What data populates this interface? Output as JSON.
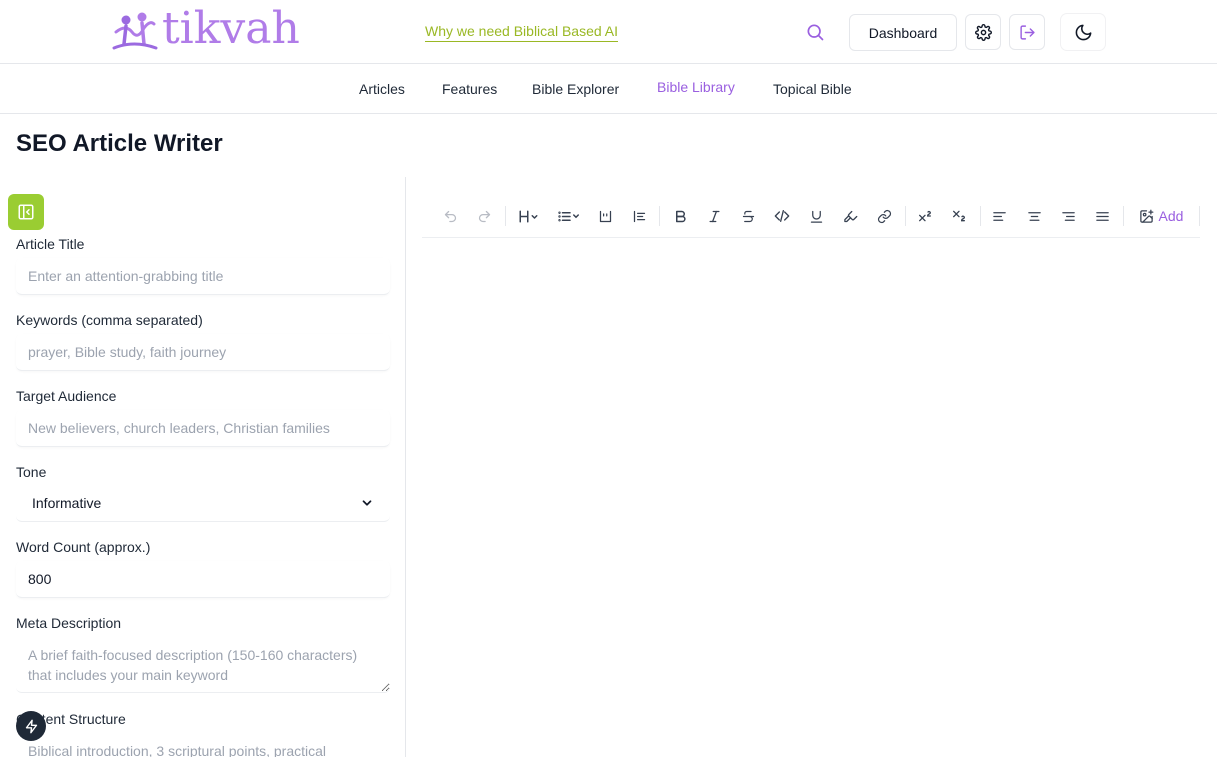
{
  "header": {
    "logo_text": "tikvah",
    "tagline": "Why we need Biblical Based AI",
    "dashboard_label": "Dashboard",
    "accent_color": "#9a5fe0",
    "tagline_color": "#9ab824"
  },
  "nav": {
    "items": [
      {
        "label": "Articles"
      },
      {
        "label": "Features"
      },
      {
        "label": "Bible Explorer"
      },
      {
        "label": "Bible Library",
        "active": true
      },
      {
        "label": "Topical Bible"
      }
    ]
  },
  "page": {
    "title": "SEO Article Writer"
  },
  "form": {
    "article_title": {
      "label": "Article Title",
      "value": "",
      "placeholder": "Enter an attention-grabbing title"
    },
    "keywords": {
      "label": "Keywords (comma separated)",
      "value": "",
      "placeholder": "prayer, Bible study, faith journey"
    },
    "audience": {
      "label": "Target Audience",
      "value": "",
      "placeholder": "New believers, church leaders, Christian families"
    },
    "tone": {
      "label": "Tone",
      "value": "Informative"
    },
    "word_count": {
      "label": "Word Count (approx.)",
      "value": "800"
    },
    "meta": {
      "label": "Meta Description",
      "value": "",
      "placeholder": "A brief faith-focused description (150-160 characters) that includes your main keyword"
    },
    "structure": {
      "label": "Content Structure",
      "value": "",
      "placeholder": "Biblical introduction, 3 scriptural points, practical"
    }
  },
  "toolbar": {
    "add_label": "Add",
    "icons": [
      "undo-icon",
      "redo-icon",
      "heading-icon",
      "list-icon",
      "blockquote-icon",
      "code-block-icon",
      "bold-icon",
      "italic-icon",
      "strikethrough-icon",
      "code-icon",
      "underline-icon",
      "highlight-icon",
      "link-icon",
      "superscript-icon",
      "subscript-icon",
      "align-left-icon",
      "align-center-icon",
      "align-right-icon",
      "align-justify-icon",
      "image-add-icon"
    ]
  },
  "sidebar": {
    "collapse_color": "#9acd32"
  }
}
